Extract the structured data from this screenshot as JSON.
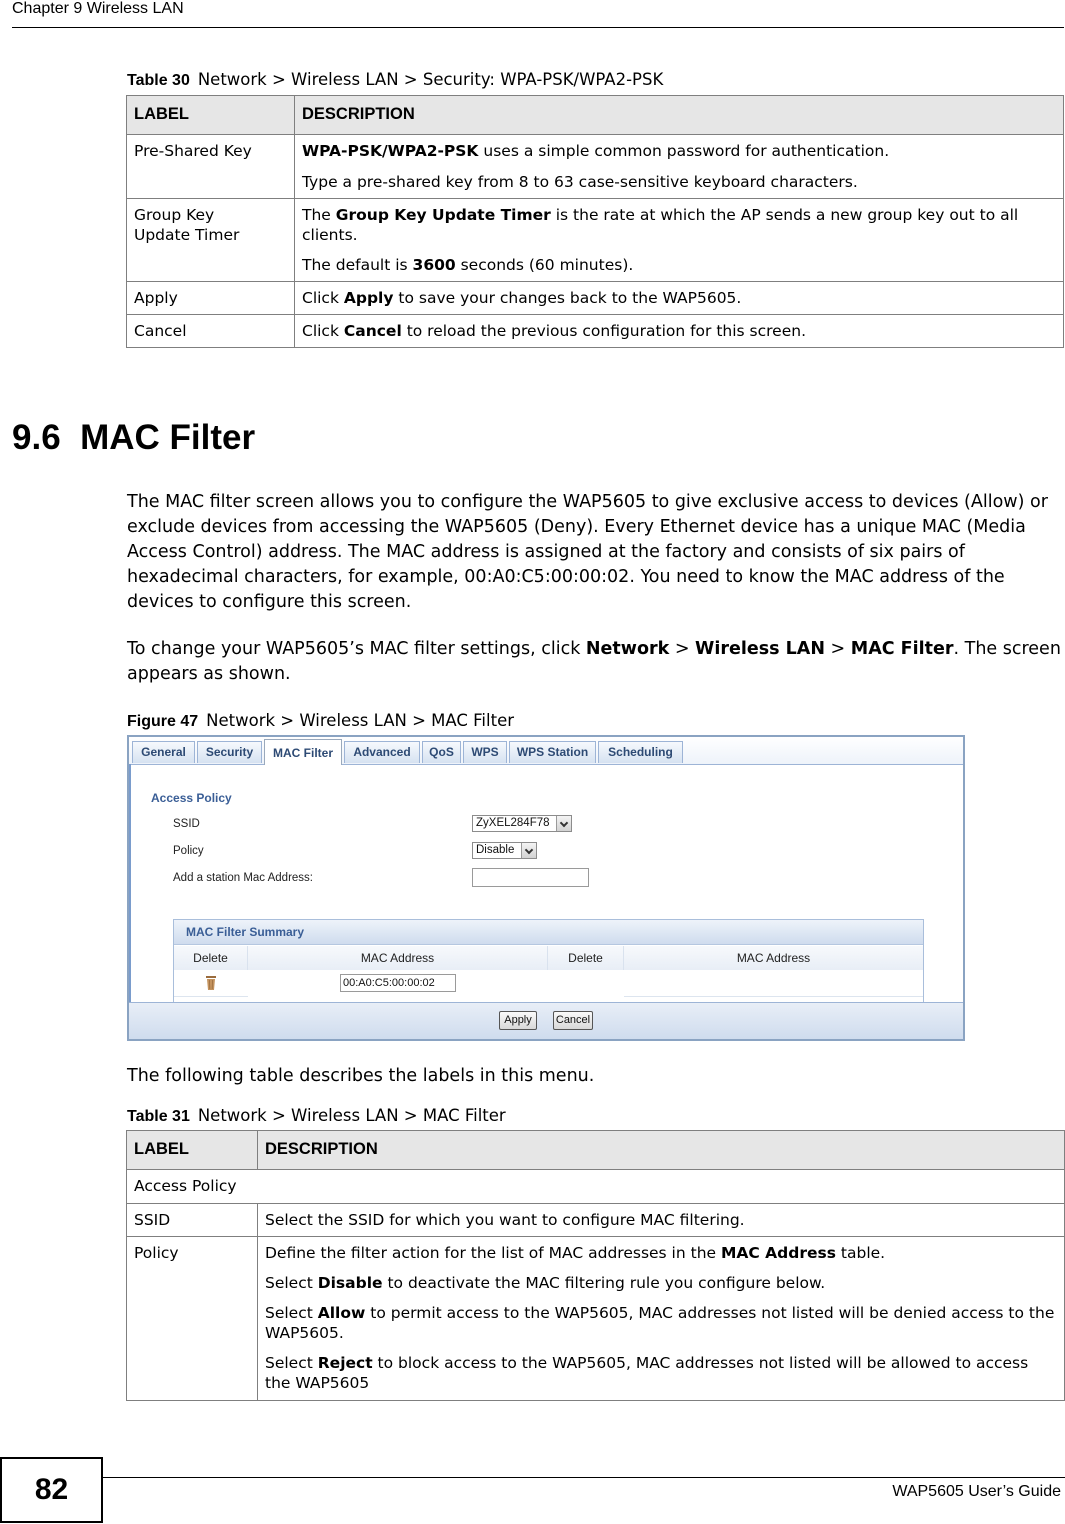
{
  "page": {
    "chapter_header": "Chapter 9 Wireless LAN",
    "page_number": "82",
    "guide_title": "WAP5605 User’s Guide"
  },
  "table30": {
    "caption_label": "Table 30",
    "caption_text": "Network > Wireless LAN > Security: WPA-PSK/WPA2-PSK",
    "headers": [
      "LABEL",
      "DESCRIPTION"
    ],
    "rows": [
      {
        "label": "Pre-Shared Key",
        "p1_bold": "WPA-PSK/WPA2-PSK",
        "p1_rest": " uses a simple common password for authentication.",
        "p2": "Type a pre-shared key from 8 to 63 case-sensitive keyboard characters."
      },
      {
        "label": "Group Key Update Timer",
        "p1_pre": "The ",
        "p1_bold": "Group Key Update Timer",
        "p1_rest": " is the rate at which the AP sends a new group key out to all clients.",
        "p2_pre": "The default is ",
        "p2_bold": "3600",
        "p2_rest": " seconds (60 minutes)."
      },
      {
        "label": "Apply",
        "pre": "Click ",
        "bold": "Apply",
        "rest": " to save your changes back to the WAP5605."
      },
      {
        "label": "Cancel",
        "pre": "Click ",
        "bold": "Cancel",
        "rest": " to reload the previous configuration for this screen."
      }
    ]
  },
  "section": {
    "number_title": "9.6  MAC Filter",
    "para1": "The MAC filter screen allows you to configure the WAP5605 to give exclusive access to devices (Allow) or exclude devices from accessing the WAP5605 (Deny). Every Ethernet device has a unique MAC (Media Access Control) address. The MAC address is assigned at the factory and consists of six pairs of hexadecimal characters, for example, 00:A0:C5:00:00:02. You need to know the MAC address of the devices to configure this screen.",
    "para2_pre": "To change your WAP5605’s MAC filter settings, click ",
    "para2_b1": "Network",
    "para2_sep1": " > ",
    "para2_b2": "Wireless LAN",
    "para2_sep2": " > ",
    "para2_b3": "MAC Filter",
    "para2_post": ". The screen appears as shown.",
    "figure_label": "Figure 47",
    "figure_caption": "Network > Wireless LAN > MAC Filter",
    "para3": "The following table describes the labels in this menu."
  },
  "figure": {
    "tabs": [
      "General",
      "Security",
      "MAC Filter",
      "Advanced",
      "QoS",
      "WPS",
      "WPS Station",
      "Scheduling"
    ],
    "active_tab": "MAC Filter",
    "access_policy_title": "Access Policy",
    "ssid_label": "SSID",
    "ssid_value": "ZyXEL284F78",
    "policy_label": "Policy",
    "policy_value": "Disable",
    "add_mac_label": "Add a station Mac Address:",
    "add_mac_value": "",
    "summary_title": "MAC Filter Summary",
    "summary_columns": [
      "Delete",
      "MAC Address",
      "Delete",
      "MAC Address"
    ],
    "summary_rows": [
      {
        "mac": "00:A0:C5:00:00:02"
      }
    ],
    "apply_label": "Apply",
    "cancel_label": "Cancel",
    "colors": {
      "tab_text": "#2d4a74",
      "section_title": "#3a5e96",
      "trash_icon": "#b8895a"
    }
  },
  "table31": {
    "caption_label": "Table 31",
    "caption_text": "Network > Wireless LAN > MAC Filter",
    "headers": [
      "LABEL",
      "DESCRIPTION"
    ],
    "section_row": "Access Policy",
    "rows": [
      {
        "label": "SSID",
        "desc": "Select the SSID for which you want to configure MAC filtering."
      },
      {
        "label": "Policy",
        "p1_pre": "Define the filter action for the list of MAC addresses in the ",
        "p1_bold": "MAC Address",
        "p1_rest": " table.",
        "p2_pre": "Select ",
        "p2_bold": "Disable",
        "p2_rest": " to deactivate the MAC filtering rule you configure below.",
        "p3_pre": "Select ",
        "p3_bold": "Allow",
        "p3_rest": " to permit access to the WAP5605, MAC addresses not listed will be denied access to the WAP5605.",
        "p4_pre": "Select ",
        "p4_bold": "Reject",
        "p4_rest": " to block access to the WAP5605, MAC addresses not listed will be allowed to access the WAP5605"
      }
    ]
  }
}
